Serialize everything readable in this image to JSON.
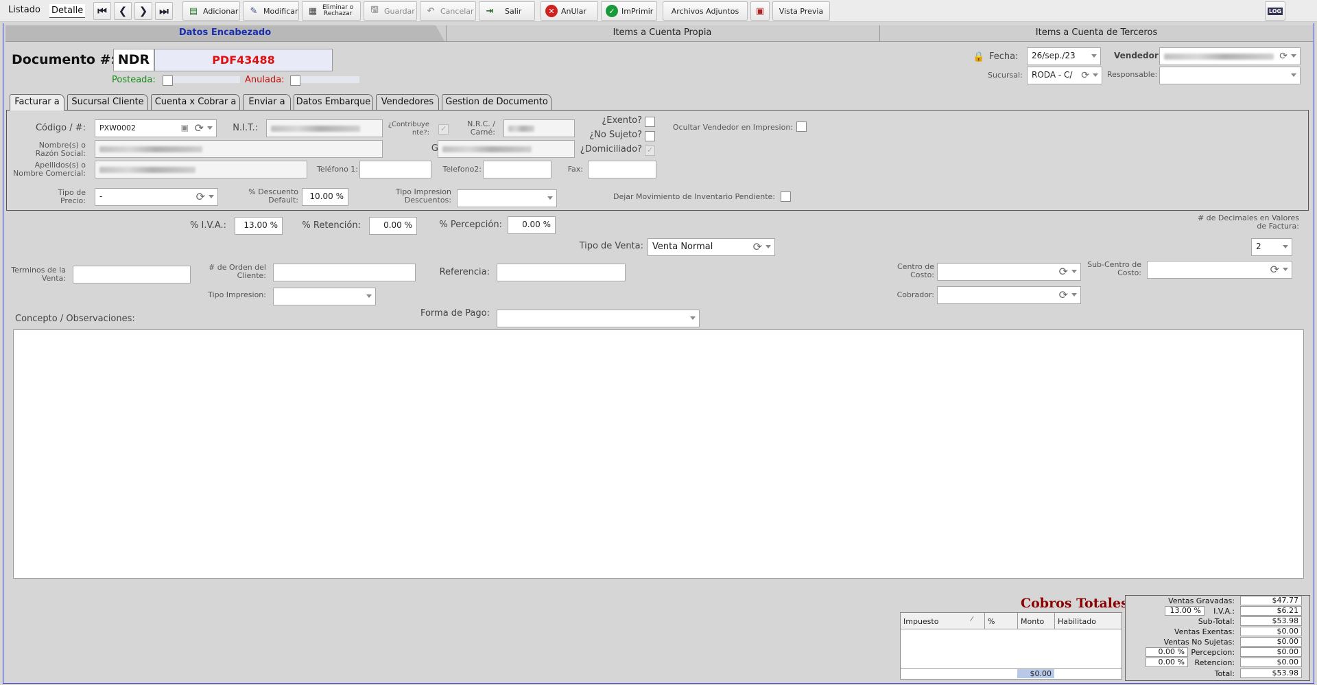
{
  "toolbar": {
    "tab_listado": "Listado",
    "tab_detalle": "Detalle",
    "adicionar": "Adicionar",
    "modificar": "Modificar",
    "eliminar_l1": "Eliminar o",
    "eliminar_l2": "Rechazar",
    "guardar": "Guardar",
    "cancelar": "Cancelar",
    "salir": "Salir",
    "anular": "AnUlar",
    "imprimir": "ImPrimir",
    "archivos": "Archivos Adjuntos",
    "vista_previa": "Vista Previa",
    "log": "LOG"
  },
  "main_tabs": [
    "Datos Encabezado",
    "Items a Cuenta Propia",
    "Items a Cuenta de Terceros"
  ],
  "header": {
    "documento_label": "Documento #:",
    "doc_type": "NDR",
    "doc_number": "PDF43488",
    "posteada": "Posteada:",
    "anulada": "Anulada:",
    "fecha_label": "Fecha:",
    "fecha": "26/sep./23",
    "vendedor_label": "Vendedor:",
    "sucursal_label": "Sucursal:",
    "sucursal": "RODA - C/",
    "responsable_label": "Responsable:"
  },
  "sub_tabs": [
    "Facturar a",
    "Sucursal Cliente",
    "Cuenta x Cobrar a",
    "Enviar a",
    "Datos Embarque",
    "Vendedores",
    "Gestion de Documento"
  ],
  "cliente": {
    "codigo_label": "Código / #:",
    "codigo": "PXW0002",
    "nit_label": "N.I.T.:",
    "contribuyente_label": "¿Contribuye nte?:",
    "nrc_label": "N.R.C. / Carné:",
    "exento": "¿Exento?",
    "no_sujeto": "¿No Sujeto?",
    "domiciliado": "¿Domiciliado?",
    "ocultar_vendedor": "Ocultar Vendedor en Impresion:",
    "nombre_label": "Nombre(s) o Razón Social:",
    "giro_label": "Giro:",
    "apellidos_label": "Apellidos(s) o Nombre Comercial:",
    "telefono1_label": "Teléfono 1:",
    "telefono2_label": "Telefono2:",
    "fax_label": "Fax:",
    "tipo_precio_label": "Tipo de Precio:",
    "tipo_precio": "-",
    "descuento_label": "% Descuento Default:",
    "descuento": "10.00 %",
    "tipo_impresion_desc_label": "Tipo Impresion Descuentos:",
    "dejar_movimiento": "Dejar Movimiento de Inventario Pendiente:"
  },
  "venta": {
    "iva_label": "% I.V.A.:",
    "iva": "13.00 %",
    "retencion_label": "% Retención:",
    "retencion": "0.00 %",
    "percepcion_label": "% Percepción:",
    "percepcion": "0.00 %",
    "decimales_label": "# de Decimales en Valores de Factura:",
    "decimales": "2",
    "tipo_venta_label": "Tipo de Venta:",
    "tipo_venta": "Venta Normal",
    "terminos_label": "Terminos de la Venta:",
    "orden_label": "# de Orden del Cliente:",
    "referencia_label": "Referencia:",
    "centro_costo_label": "Centro de Costo:",
    "subcentro_label": "Sub-Centro de Costo:",
    "tipo_impresion_label": "Tipo Impresion:",
    "cobrador_label": "Cobrador:",
    "concepto_label": "Concepto / Observaciones:",
    "forma_pago_label": "Forma de Pago:"
  },
  "cobros": {
    "title": "Cobros Totales",
    "columns": [
      "Impuesto",
      "%",
      "Monto",
      "Habilitado"
    ],
    "total": "$0.00"
  },
  "totales": {
    "ventas_gravadas_label": "Ventas Gravadas:",
    "ventas_gravadas": "$47.77",
    "iva_pct": "13.00 %",
    "iva_label": "I.V.A.:",
    "iva": "$6.21",
    "subtotal_label": "Sub-Total:",
    "subtotal": "$53.98",
    "exentas_label": "Ventas Exentas:",
    "exentas": "$0.00",
    "no_sujetas_label": "Ventas No Sujetas:",
    "no_sujetas": "$0.00",
    "percepcion_pct": "0.00 %",
    "percepcion_label": "Percepcion:",
    "percepcion": "$0.00",
    "retencion_pct": "0.00 %",
    "retencion_label": "Retencion:",
    "retencion": "$0.00",
    "total_label": "Total:",
    "total": "$53.98"
  },
  "colors": {
    "doc_number": "#e01010",
    "tab_active": "#1a2fb0",
    "cobros_title": "#8b0000",
    "posteada": "#1a8a1a",
    "anulada": "#c41010"
  }
}
